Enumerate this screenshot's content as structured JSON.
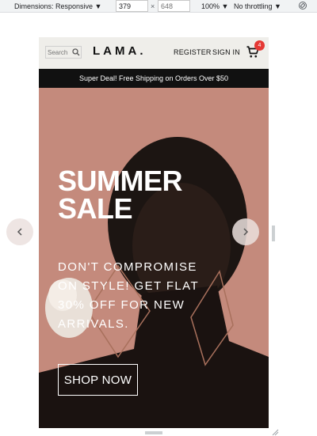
{
  "devtools": {
    "dimensions_label": "Dimensions: Responsive ▼",
    "width_value": "379",
    "height_placeholder": "648",
    "times": "×",
    "zoom": "100% ▼",
    "throttling": "No throttling ▼",
    "rotate_icon": "rotate-icon"
  },
  "navbar": {
    "search_placeholder": "Search",
    "logo": "LAMA.",
    "register": "REGISTER",
    "signin": "SIGN IN",
    "cart_count": "4"
  },
  "announcement": "Super Deal! Free Shipping on Orders Over $50",
  "hero": {
    "title": "SUMMER SALE",
    "description": "DON'T COMPROMISE ON STYLE! GET FLAT 30% OFF FOR NEW ARRIVALS.",
    "button": "SHOP NOW",
    "background_color": "#c48a7c"
  },
  "colors": {
    "navbar_bg": "#efeeea",
    "announcement_bg": "#111111",
    "badge": "#e53935"
  }
}
